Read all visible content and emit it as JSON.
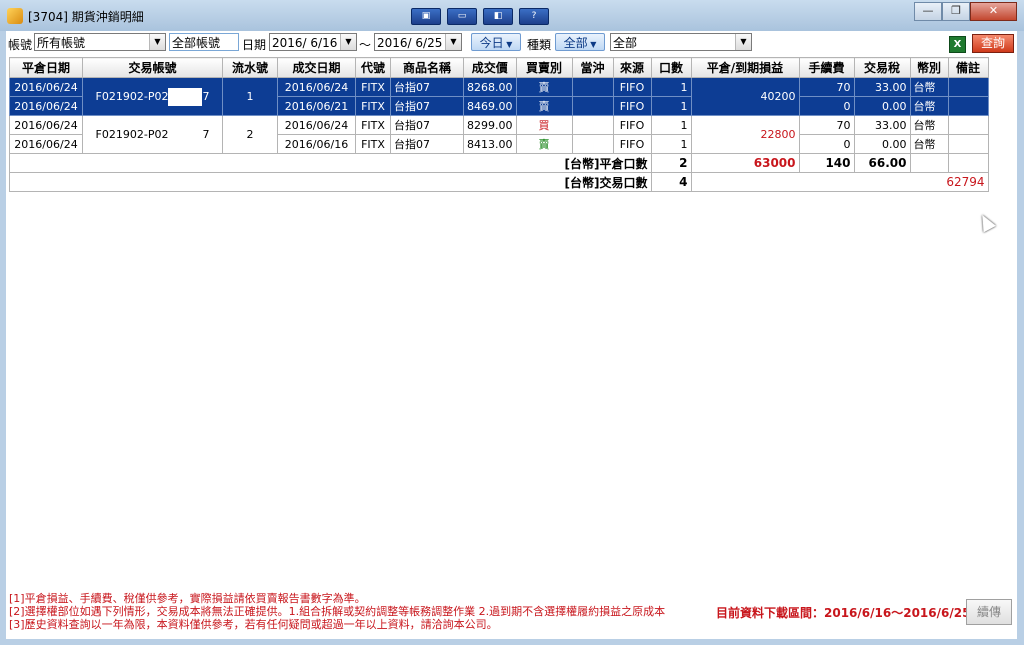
{
  "window": {
    "title": "[3704] 期貨沖銷明細",
    "tool_buttons": [
      "▣",
      "▭",
      "◧",
      "?"
    ],
    "ctrl_min": "—",
    "ctrl_max": "❐",
    "ctrl_close": "✕"
  },
  "toolbar": {
    "account_label": "帳號",
    "account_value": "所有帳號",
    "account_text": "全部帳號",
    "date_label": "日期",
    "date_from": "2016/ 6/16",
    "tilde": "～",
    "date_to": "2016/ 6/25",
    "today_label": "今日",
    "type_label": "種類",
    "type_value": "全部",
    "product_value": "全部",
    "excel_icon": "X",
    "query_label": "查詢"
  },
  "table": {
    "headers": [
      "平倉日期",
      "交易帳號",
      "流水號",
      "成交日期",
      "代號",
      "商品名稱",
      "成交價",
      "買賣別",
      "當沖",
      "來源",
      "口數",
      "平倉/到期損益",
      "手續費",
      "交易稅",
      "幣別",
      "備註"
    ],
    "groups": [
      {
        "account_prefix": "F021902-P02",
        "account_suffix": "7",
        "serial": "1",
        "pnl": "40200",
        "rows": [
          {
            "close_date": "2016/06/24",
            "trade_date": "2016/06/24",
            "code": "FITX",
            "product": "台指07",
            "price": "8268.00",
            "side": "賣",
            "daytrade": "",
            "source": "FIFO",
            "qty": "1",
            "fee": "70",
            "tax": "33.00",
            "currency": "台幣",
            "note": ""
          },
          {
            "close_date": "2016/06/24",
            "trade_date": "2016/06/21",
            "code": "FITX",
            "product": "台指07",
            "price": "8469.00",
            "side": "賣",
            "daytrade": "",
            "source": "FIFO",
            "qty": "1",
            "fee": "0",
            "tax": "0.00",
            "currency": "台幣",
            "note": ""
          }
        ]
      },
      {
        "account_prefix": "F021902-P02",
        "account_suffix": "7",
        "serial": "2",
        "pnl": "22800",
        "rows": [
          {
            "close_date": "2016/06/24",
            "trade_date": "2016/06/24",
            "code": "FITX",
            "product": "台指07",
            "price": "8299.00",
            "side": "買",
            "daytrade": "",
            "source": "FIFO",
            "qty": "1",
            "fee": "70",
            "tax": "33.00",
            "currency": "台幣",
            "note": ""
          },
          {
            "close_date": "2016/06/24",
            "trade_date": "2016/06/16",
            "code": "FITX",
            "product": "台指07",
            "price": "8413.00",
            "side": "賣",
            "daytrade": "",
            "source": "FIFO",
            "qty": "1",
            "fee": "0",
            "tax": "0.00",
            "currency": "台幣",
            "note": ""
          }
        ]
      }
    ],
    "summary_close": {
      "label": "[台幣]平倉口數",
      "qty": "2",
      "pnl": "63000",
      "fee": "140",
      "tax": "66.00"
    },
    "summary_trade": {
      "label": "[台幣]交易口數",
      "qty": "4",
      "net": "62794"
    }
  },
  "footer": {
    "note1": "[1]平倉損益、手續費、稅僅供參考，實際損益請依買賣報告書數字為準。",
    "note2": "[2]選擇權部位如遇下列情形，交易成本將無法正確提供。1.組合拆解或契約調整等帳務調整作業 2.過到期不含選擇權履約損益之原成本",
    "note3": "[3]歷史資料查詢以一年為限，本資料僅供參考，若有任何疑問或超過一年以上資料，請洽詢本公司。",
    "range_label": "目前資料下載區間：2016/6/16～2016/6/25",
    "resend_label": "續傳"
  },
  "colors": {
    "selection": "#0d3d94",
    "sell": "#007a00",
    "buy": "#c8161c",
    "accent_red": "#c8161c"
  }
}
